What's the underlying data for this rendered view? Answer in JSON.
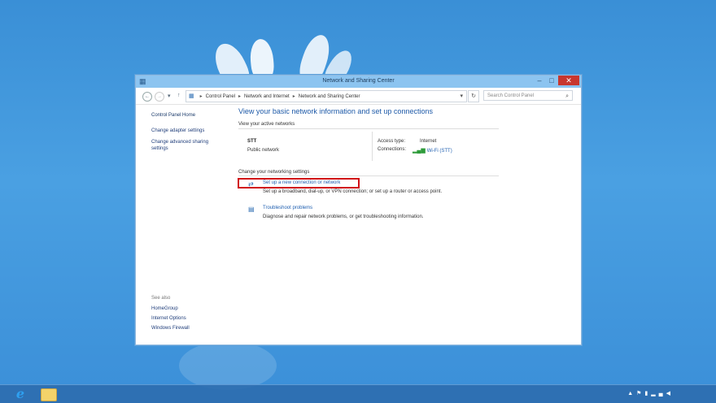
{
  "window": {
    "title": "Network and Sharing Center",
    "controls": {
      "minimize": "–",
      "maximize": "□",
      "close": "✕"
    }
  },
  "address": {
    "breadcrumbs": [
      "Control Panel",
      "Network and Internet",
      "Network and Sharing Center"
    ],
    "search_placeholder": "Search Control Panel"
  },
  "sidebar": {
    "home": "Control Panel Home",
    "links": [
      "Change adapter settings",
      "Change advanced sharing settings"
    ],
    "see_also_label": "See also",
    "see_also": [
      "HomeGroup",
      "Internet Options",
      "Windows Firewall"
    ]
  },
  "main": {
    "heading": "View your basic network information and set up connections",
    "active_networks_label": "View your active networks",
    "network": {
      "name": "STT",
      "category": "Public network",
      "access_type_label": "Access type:",
      "access_type_value": "Internet",
      "connections_label": "Connections:",
      "connections_value": "Wi-Fi (STT)"
    },
    "change_settings_label": "Change your networking settings",
    "tasks": [
      {
        "link": "Set up a new connection or network",
        "description": "Set up a broadband, dial-up, or VPN connection; or set up a router or access point.",
        "icon": "new-connection-icon"
      },
      {
        "link": "Troubleshoot problems",
        "description": "Diagnose and repair network problems, or get troubleshooting information.",
        "icon": "troubleshoot-icon"
      }
    ]
  },
  "colors": {
    "link": "#1f5fb0",
    "heading": "#1e5aa8",
    "highlight": "#d10f16",
    "titlebar": "#8cc4f0",
    "desktop": "#4aa0e2"
  }
}
